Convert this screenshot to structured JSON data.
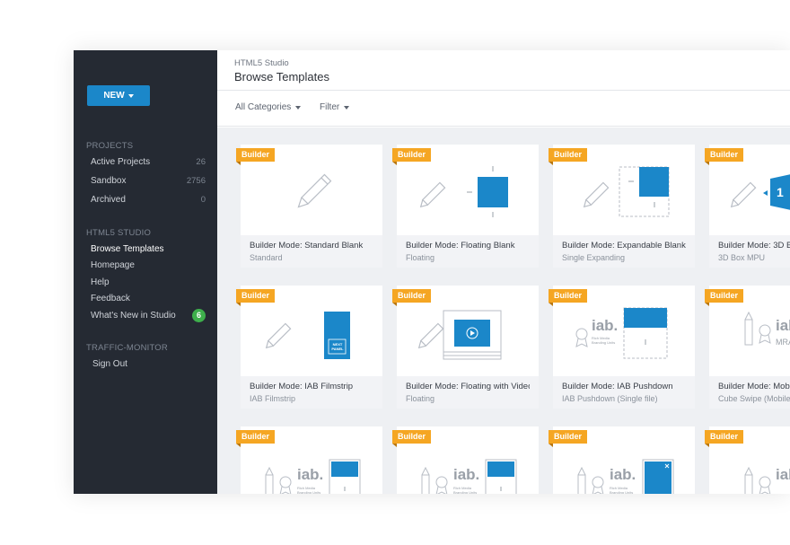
{
  "sidebar": {
    "new_button": "NEW",
    "projects_title": "PROJECTS",
    "projects": [
      {
        "label": "Active Projects",
        "count": "26"
      },
      {
        "label": "Sandbox",
        "count": "2756"
      },
      {
        "label": "Archived",
        "count": "0"
      }
    ],
    "studio_title": "HTML5 STUDIO",
    "studio_items": [
      {
        "label": "Browse Templates"
      },
      {
        "label": "Homepage"
      },
      {
        "label": "Help"
      },
      {
        "label": "Feedback"
      },
      {
        "label": "What's New in Studio",
        "badge": "6"
      }
    ],
    "traffic_title": "TRAFFIC-MONITOR",
    "traffic_items": [
      {
        "label": "Sign Out"
      }
    ]
  },
  "header": {
    "breadcrumb": "HTML5 Studio",
    "title": "Browse Templates"
  },
  "filters": {
    "categories": "All Categories",
    "filter": "Filter"
  },
  "colors": {
    "accent": "#1b87c9",
    "tag": "#f5a623",
    "sidebar": "#252a33",
    "badge": "#3eaf4c"
  },
  "tag_label": "Builder",
  "cards": [
    {
      "title": "Builder Mode: Standard Blank",
      "subtitle": "Standard",
      "icon": "pencil-icon"
    },
    {
      "title": "Builder Mode: Floating Blank",
      "subtitle": "Floating",
      "icon": "floating-ad-icon"
    },
    {
      "title": "Builder Mode: Expandable Blank",
      "subtitle": "Single Expanding",
      "icon": "expandable-ad-icon"
    },
    {
      "title": "Builder Mode: 3D B",
      "subtitle": "3D Box MPU",
      "icon": "cube-icon",
      "cube_label": "1"
    },
    {
      "title": "Builder Mode: IAB Filmstrip",
      "subtitle": "IAB Filmstrip",
      "icon": "filmstrip-icon",
      "panel_label": "NEXT PANEL"
    },
    {
      "title": "Builder Mode: Floating with Video",
      "subtitle": "Floating",
      "icon": "video-icon"
    },
    {
      "title": "Builder Mode: IAB Pushdown",
      "subtitle": "IAB Pushdown (Single file)",
      "icon": "iab-pushdown-icon",
      "iab_label": "iab.",
      "iab_sub": "Rich Media Branding Units"
    },
    {
      "title": "Builder Mode: Mob",
      "subtitle": "Cube Swipe (Mobile",
      "icon": "iab-mobile-icon",
      "iab_label": "iab",
      "iab_sub": "MRA"
    },
    {
      "title": "",
      "subtitle": "",
      "icon": "iab-unit-icon",
      "iab_label": "iab.",
      "iab_sub": "Rich Media Branding Units"
    },
    {
      "title": "",
      "subtitle": "",
      "icon": "iab-unit-icon",
      "iab_label": "iab.",
      "iab_sub": "Rich Media Branding Units"
    },
    {
      "title": "",
      "subtitle": "",
      "icon": "iab-unit-icon",
      "iab_label": "iab.",
      "iab_sub": "Rich Media Branding Units"
    },
    {
      "title": "",
      "subtitle": "",
      "icon": "iab-unit-icon",
      "iab_label": "iab",
      "iab_sub": ""
    }
  ]
}
